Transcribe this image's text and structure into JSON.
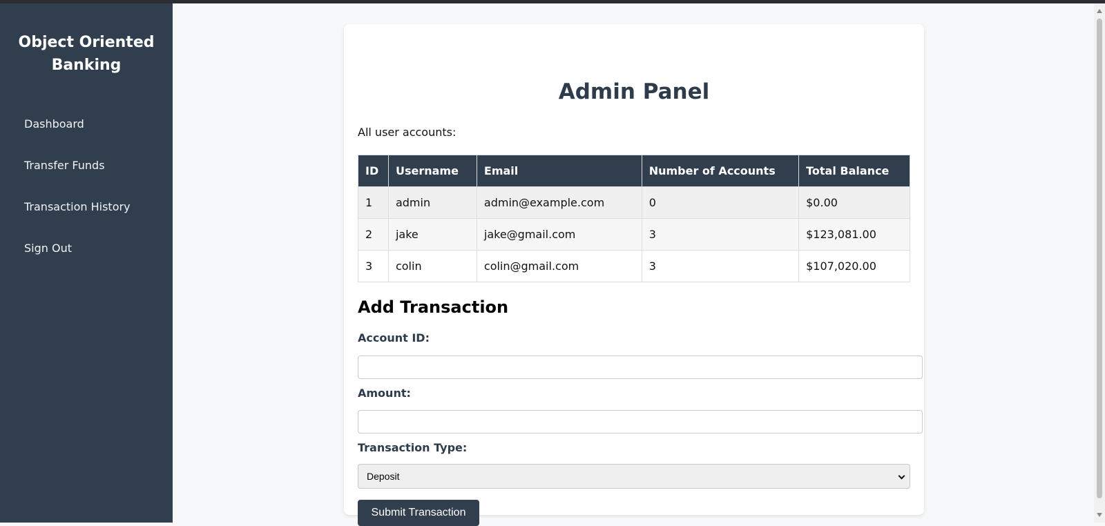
{
  "sidebar": {
    "brand": "Object Oriented Banking",
    "items": [
      {
        "label": "Dashboard"
      },
      {
        "label": "Transfer Funds"
      },
      {
        "label": "Transaction History"
      },
      {
        "label": "Sign Out"
      }
    ]
  },
  "main": {
    "title": "Admin Panel",
    "subtitle": "All user accounts:",
    "table": {
      "headers": [
        "ID",
        "Username",
        "Email",
        "Number of Accounts",
        "Total Balance"
      ],
      "rows": [
        [
          "1",
          "admin",
          "admin@example.com",
          "0",
          "$0.00"
        ],
        [
          "2",
          "jake",
          "jake@gmail.com",
          "3",
          "$123,081.00"
        ],
        [
          "3",
          "colin",
          "colin@gmail.com",
          "3",
          "$107,020.00"
        ]
      ]
    },
    "form": {
      "title": "Add Transaction",
      "account_id_label": "Account ID:",
      "account_id_value": "",
      "amount_label": "Amount:",
      "amount_value": "",
      "type_label": "Transaction Type:",
      "type_selected": "Deposit",
      "submit_label": "Submit Transaction"
    }
  },
  "colors": {
    "sidebar_bg": "#313e4e",
    "header_bg": "#313e4e",
    "page_bg": "#f7f8fa",
    "title_color": "#2d3b4b"
  }
}
